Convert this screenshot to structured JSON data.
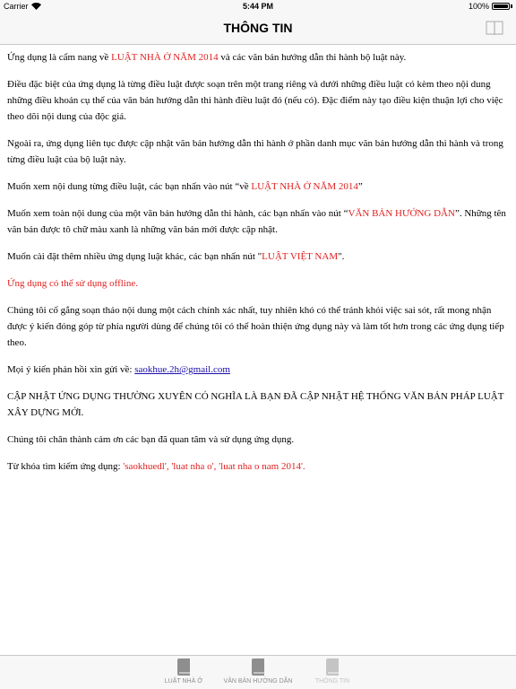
{
  "status_bar": {
    "carrier": "Carrier",
    "time": "5:44 PM",
    "battery_text": "100%",
    "battery_level": 1.0
  },
  "nav": {
    "title": "THÔNG TIN",
    "right_icon": "book-icon"
  },
  "content": {
    "p1": {
      "a": "Ứng dụng là cẩm nang về ",
      "b": "LUẬT NHÀ Ở  NĂM 2014",
      "c": " và các văn bản hướng dẫn thi hành bộ luật này."
    },
    "p2": "Điều đặc biệt của ứng dụng là từng điều luật được soạn trên một trang riêng và dưới những điều luật có kèm theo nội dung những điều khoản cụ thể của văn bản hướng dẫn thi hành điều luật đó (nếu có). Đặc điểm này tạo điều kiện thuận lợi cho việc theo dõi nội dung của độc giả.",
    "p3": "Ngoài ra, ứng dụng liên tục được cập nhật văn bản hướng dẫn thi hành ở phần danh mục văn bản hướng dẫn thi hành và trong từng điều luật của bộ luật này.",
    "p4": {
      "a": "Muốn xem nội dung từng điều luật, các bạn nhấn vào nút “về ",
      "b": "LUẬT NHÀ Ở  NĂM 2014",
      "c": "”"
    },
    "p5": {
      "a": "Muốn xem toàn nội dung của một văn bản hướng dẫn thi hành, các bạn nhấn vào nút “",
      "b": "VĂN BẢN HƯỚNG DẪN",
      "c": "”.  Những tên văn bản được tô chữ màu xanh là những văn bản mới được cập nhật."
    },
    "p6": {
      "a": "Muốn cài đặt thêm nhiều ứng dụng luật khác, các bạn nhấn nút \"",
      "b": "LUẬT VIỆT NAM",
      "c": "\"."
    },
    "p7": "Ứng dụng có thể sử dụng offline.",
    "p8": "Chúng tôi cố gắng soạn thảo nội dung một cách chính xác nhất, tuy nhiên khó có thể tránh khỏi việc sai sót, rất mong nhận được ý kiến đóng góp từ phía người dùng để chúng tôi có thể hoàn thiện ứng dụng này và làm tốt hơn trong các ứng dụng tiếp theo.",
    "p9": {
      "a": "Mọi ý kiến phản hồi xin gửi về: ",
      "email": "saokhue.2h@gmail.com"
    },
    "p10": "CẬP NHẬT ỨNG DỤNG THƯỜNG XUYÊN CÓ NGHĨA LÀ BẠN ĐÃ CẬP NHẬT HỆ THỐNG VĂN BẢN PHÁP LUẬT XÂY DỰNG MỚI.",
    "p11": "Chúng tôi chân thành cảm ơn các bạn đã quan tâm và sử dụng ứng dụng.",
    "p12": {
      "a": "Từ khóa tìm kiếm ứng dụng: ",
      "b": "'saokhuedl', 'luat nha o', 'luat nha o nam 2014'."
    }
  },
  "tabs": [
    {
      "label": "LUẬT NHÀ Ở",
      "icon": "book-icon"
    },
    {
      "label": "VĂN BẢN HƯỚNG DẪN",
      "icon": "book-icon"
    },
    {
      "label": "THÔNG TIN",
      "icon": "book-icon"
    }
  ],
  "colors": {
    "red_text": "#e02020",
    "link": "#1a0dab",
    "tab_inactive": "#8e8e8e",
    "tab_active": "#c4c4c4"
  }
}
